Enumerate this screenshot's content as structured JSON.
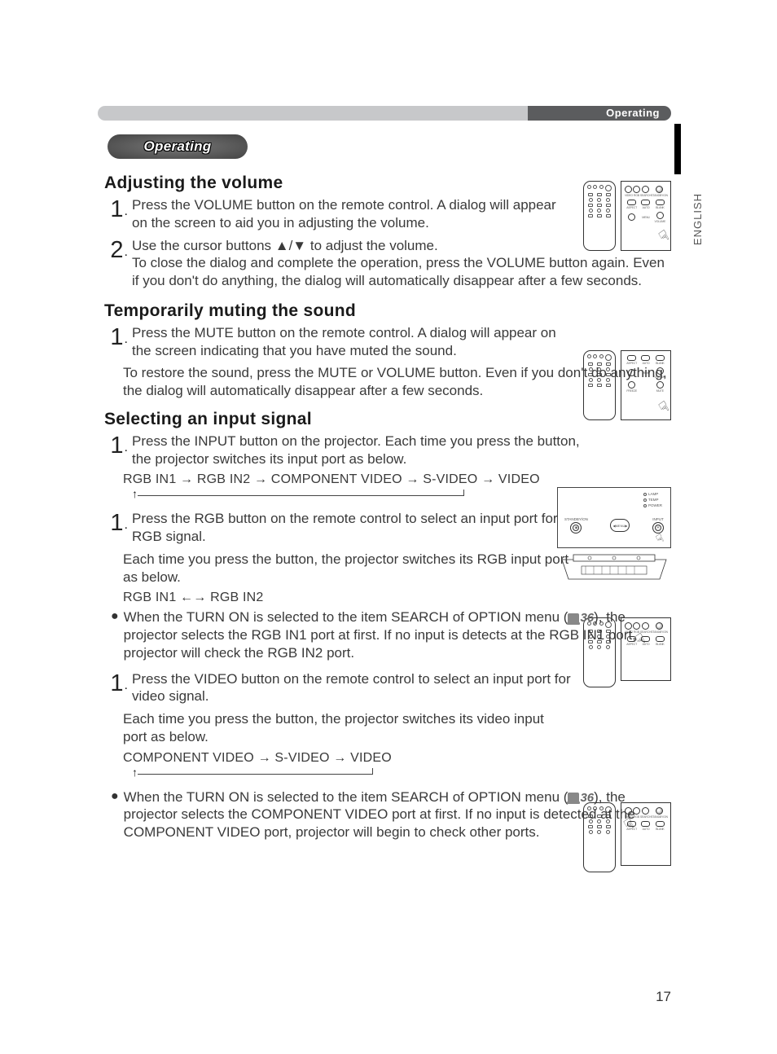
{
  "header": {
    "top_bar_label": "Operating",
    "side_lang": "ENGLISH",
    "section_pill": "Operating"
  },
  "volume": {
    "heading": "Adjusting the volume",
    "step1": "Press the VOLUME button on the remote control.\nA dialog will appear on the screen to aid you in adjusting the volume.",
    "step2a": "Use the cursor buttons ▲/▼ to adjust the volume.",
    "step2b": "To close the dialog and complete the operation, press the VOLUME button again. Even if you don't do anything, the dialog will automatically disappear after a few seconds."
  },
  "mute": {
    "heading": "Temporarily muting the sound",
    "step1": "Press the MUTE button on the remote control.\nA dialog will appear on the screen indicating that you have muted the sound.",
    "step1b": "To restore the sound, press the MUTE or VOLUME button. Even if you don't do anything, the dialog will automatically disappear after a few seconds."
  },
  "input": {
    "heading": "Selecting an input signal",
    "step1": "Press the INPUT button on the projector.\nEach time you press the button, the projector switches its input port as below.",
    "cycle1": "RGB IN1 → RGB IN2 → COMPONENT VIDEO → S-VIDEO → VIDEO",
    "step_rgb_a": "Press the RGB button on the remote control to select an input port for RGB signal.",
    "step_rgb_b": "Each time you press the button, the projector switches its RGB input port as below.",
    "cycle_rgb": "RGB IN1 ←→ RGB IN2",
    "bullet_rgb": "When the TURN ON is selected to the item SEARCH of OPTION menu (",
    "bullet_rgb_ref": "36",
    "bullet_rgb_b": "), the projector selects the RGB IN1 port at first. If no input is detects at the RGB IN1 port, projector will check the RGB IN2 port.",
    "step_vid_a": "Press the VIDEO button on the remote control to select an input port for video signal.",
    "step_vid_b": "Each time you press the button, the projector switches its video input port as below.",
    "cycle_vid": "COMPONENT VIDEO → S-VIDEO → VIDEO",
    "bullet_vid": "When the TURN ON is selected to the item SEARCH of OPTION menu (",
    "bullet_vid_ref": "36",
    "bullet_vid_b": "), the projector selects the COMPONENT VIDEO port at first. If no input is detected at the COMPONENT VIDEO port, projector will begin to check other ports."
  },
  "remote_labels": {
    "r1": [
      "VIDEO",
      "RGB",
      "SEARCH",
      "STANDBY/ON"
    ],
    "r2": [
      "ASPECT",
      "AUTO",
      "BLANK"
    ],
    "r3": [
      "MENU",
      "VOLUME"
    ],
    "r4": [
      "FREEZE",
      "MUTE"
    ]
  },
  "projector_labels": {
    "leds": [
      "LAMP",
      "TEMP",
      "POWER"
    ],
    "buttons": [
      "STANDBY/ON",
      "MENU",
      "INPUT"
    ]
  },
  "pagenum": "17"
}
